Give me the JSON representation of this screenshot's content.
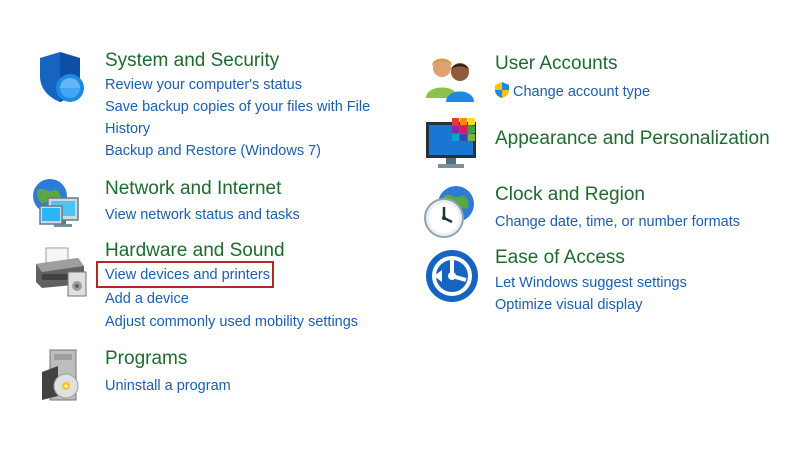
{
  "left": {
    "system_security": {
      "title": "System and Security",
      "icon": "shield-icon",
      "links": [
        "Review your computer's status",
        "Save backup copies of your files with File History",
        "Backup and Restore (Windows 7)"
      ]
    },
    "network_internet": {
      "title": "Network and Internet",
      "icon": "network-globe-icon",
      "links": [
        "View network status and tasks"
      ]
    },
    "hardware_sound": {
      "title": "Hardware and Sound",
      "icon": "printer-icon",
      "links": [
        "View devices and printers",
        "Add a device",
        "Adjust commonly used mobility settings"
      ],
      "highlighted_link_index": 0,
      "highlight_color": "#b3262e"
    },
    "programs": {
      "title": "Programs",
      "icon": "programs-disc-icon",
      "links": [
        "Uninstall a program"
      ]
    }
  },
  "right": {
    "user_accounts": {
      "title": "User Accounts",
      "icon": "users-icon",
      "links": [
        "Change account type"
      ],
      "link_icon": "uac-shield-icon"
    },
    "appearance": {
      "title": "Appearance and Personalization",
      "icon": "monitor-colors-icon",
      "links": []
    },
    "clock_region": {
      "title": "Clock and Region",
      "icon": "clock-globe-icon",
      "links": [
        "Change date, time, or number formats"
      ]
    },
    "ease_access": {
      "title": "Ease of Access",
      "icon": "ease-of-access-icon",
      "links": [
        "Let Windows suggest settings",
        "Optimize visual display"
      ]
    }
  },
  "colors": {
    "title_green": "#1e6b2e",
    "link_blue": "#1b5fad"
  }
}
